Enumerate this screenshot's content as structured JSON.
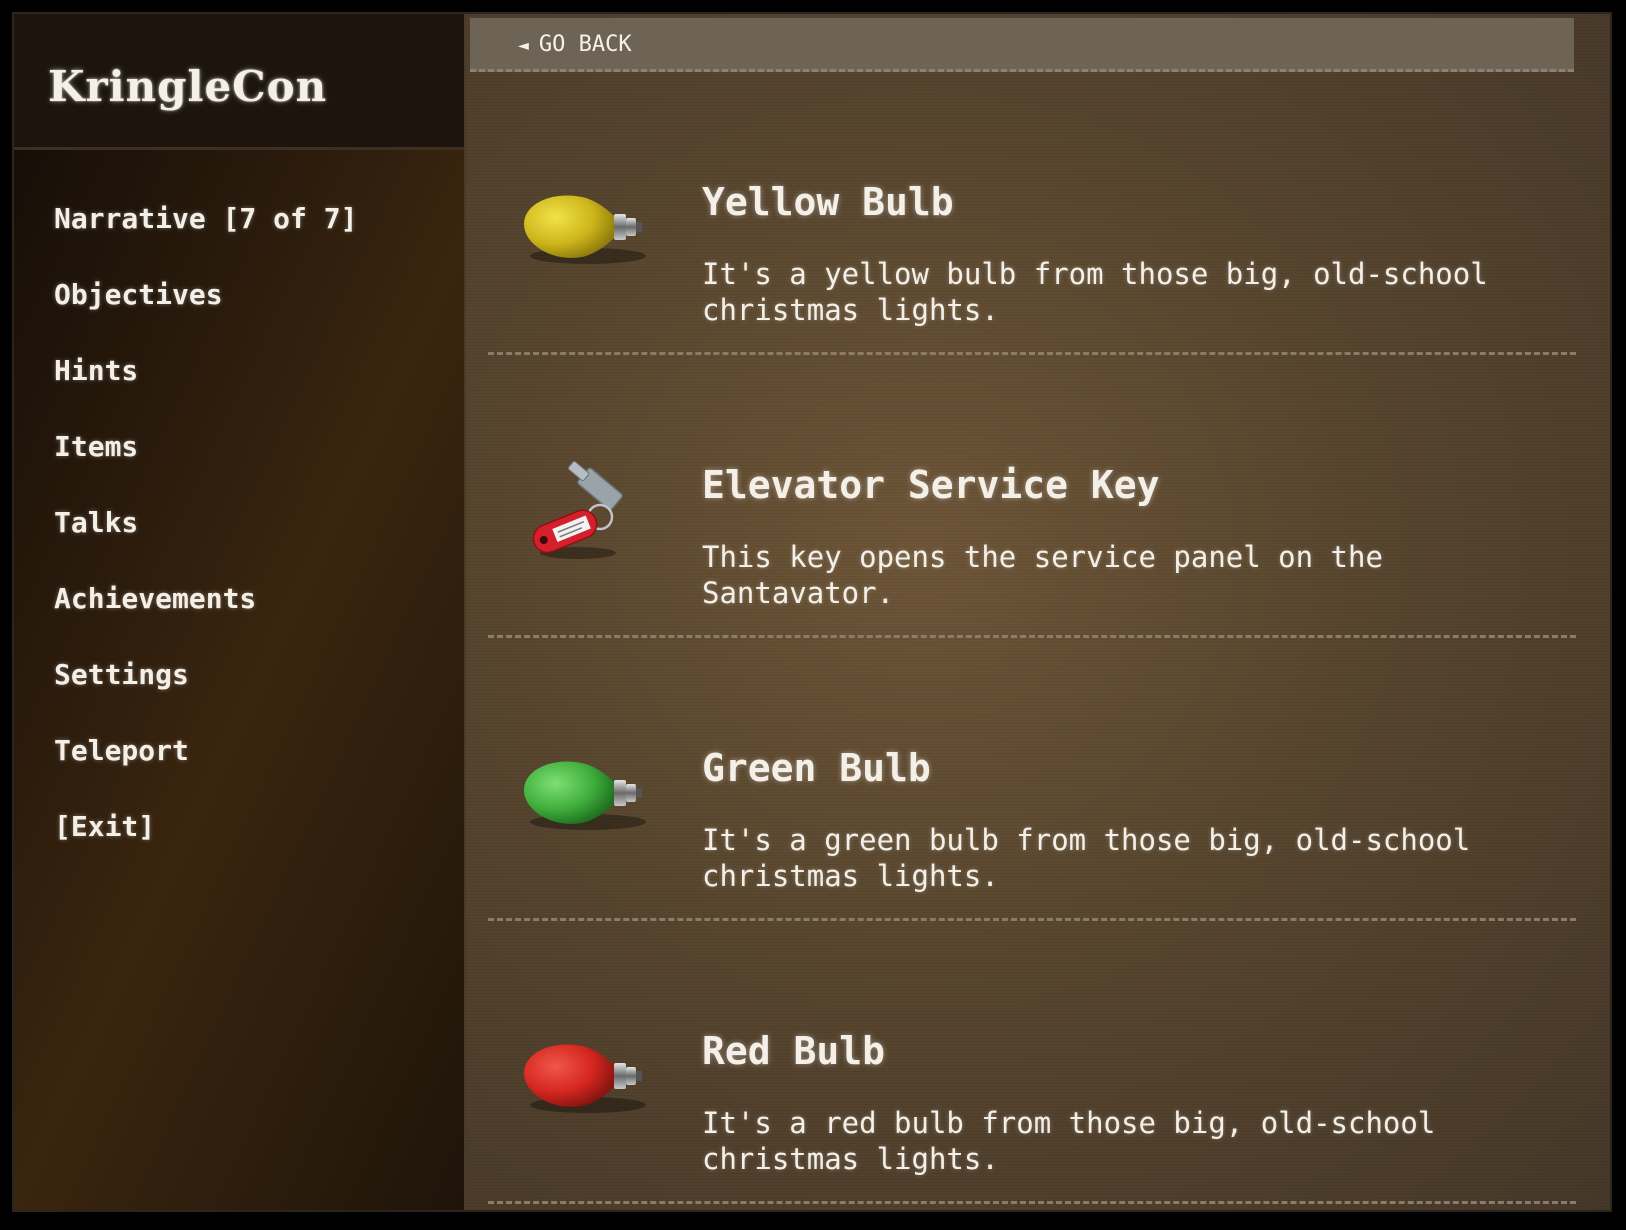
{
  "app": {
    "title": "KringleCon"
  },
  "sidebar": {
    "items": [
      {
        "label": "Narrative [7 of 7]"
      },
      {
        "label": "Objectives"
      },
      {
        "label": "Hints"
      },
      {
        "label": "Items"
      },
      {
        "label": "Talks"
      },
      {
        "label": "Achievements"
      },
      {
        "label": "Settings"
      },
      {
        "label": "Teleport"
      },
      {
        "label": "[Exit]"
      }
    ]
  },
  "main": {
    "back_label": "GO BACK",
    "back_icon": "back-triangle-icon",
    "items": [
      {
        "name": "Yellow Bulb",
        "description": "It's a yellow bulb from those big, old-school christmas lights.",
        "icon": "yellow-bulb-icon",
        "color": "#d6c21e"
      },
      {
        "name": "Elevator Service Key",
        "description": "This key opens the service panel on the Santavator.",
        "icon": "service-key-icon",
        "color": "#d3202a"
      },
      {
        "name": "Green Bulb",
        "description": "It's a green bulb from those big, old-school christmas lights.",
        "icon": "green-bulb-icon",
        "color": "#3fae3c"
      },
      {
        "name": "Red Bulb",
        "description": "It's a red bulb from those big, old-school christmas lights.",
        "icon": "red-bulb-icon",
        "color": "#d4261f"
      }
    ]
  }
}
